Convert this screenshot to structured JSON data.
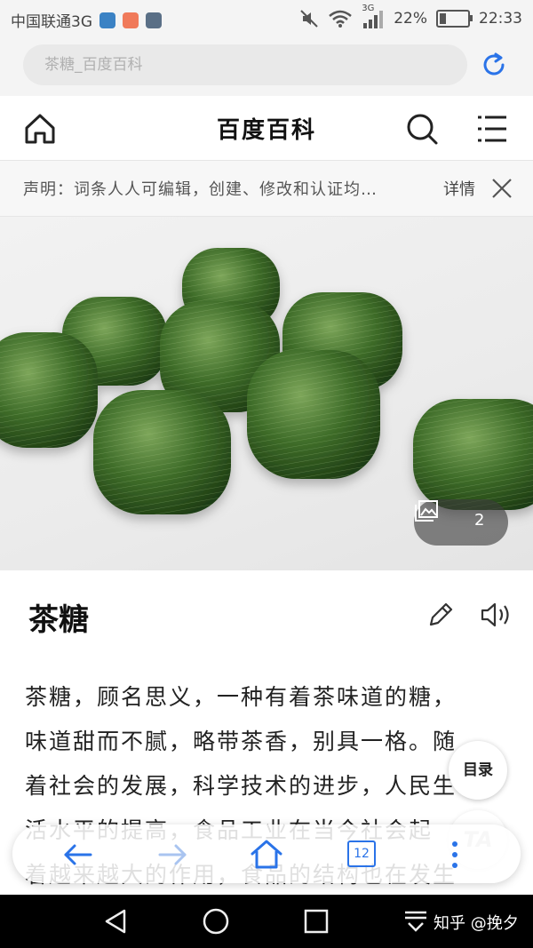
{
  "status_bar": {
    "carrier": "中国联通3G",
    "network": "3G",
    "battery": "22%",
    "battery_level": 0.22,
    "time": "22:33"
  },
  "browser": {
    "url_text": "茶糖_百度百科",
    "tab_count": "12"
  },
  "header": {
    "title": "百度百科"
  },
  "notice": {
    "text": "声明：词条人人可编辑，创建、修改和认证均…",
    "link": "详情"
  },
  "hero": {
    "gallery_count": "2"
  },
  "entry": {
    "title": "茶糖",
    "lines": [
      "茶糖，顾名思义，一种有着茶味道的糖，",
      "味道甜而不腻，略带茶香，别具一格。随",
      "着社会的发展，科学技术的进步，人民生",
      "活水平的提高，食品工业在当今社会起",
      "着越来越大的作用，食品的结构也在发生"
    ]
  },
  "floating": {
    "toc_label": "目录",
    "ta_label": "TA"
  },
  "navbar": {
    "watermark": "知乎 @挽夕"
  },
  "colors": {
    "accent": "#2a73e8",
    "candy_dark": "#2f5a1f",
    "candy_light": "#6e9a4a"
  }
}
